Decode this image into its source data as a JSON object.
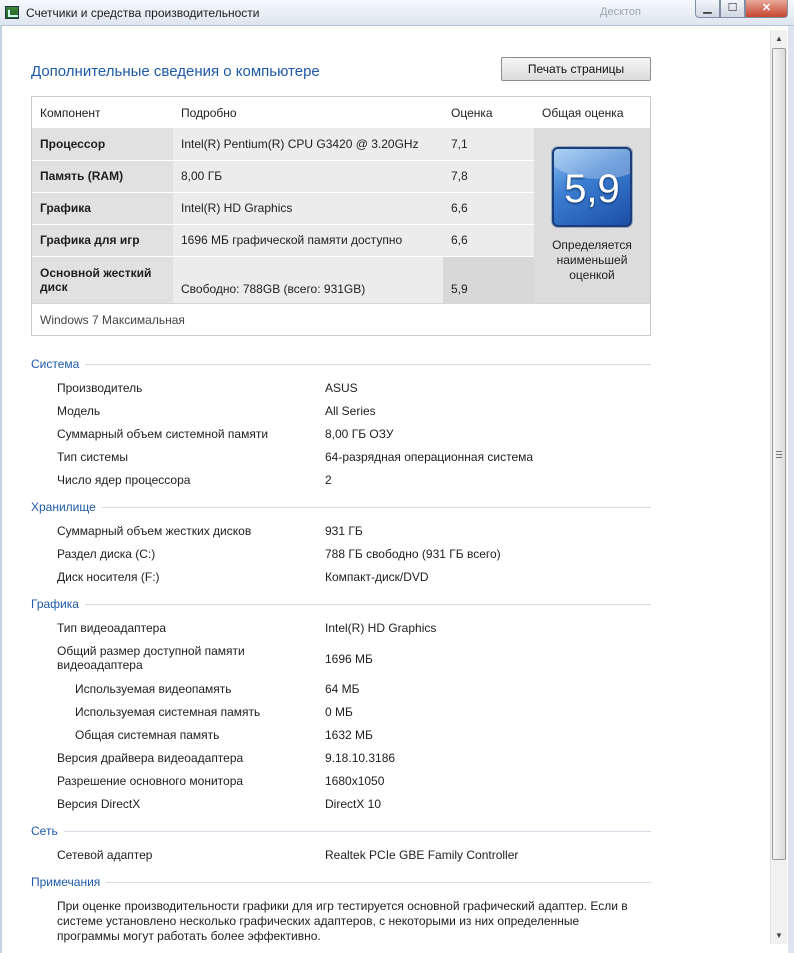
{
  "window": {
    "title": "Счетчики и средства производительности",
    "ghost": "Десктоп",
    "min": "▁",
    "max": "☐",
    "close": "✕"
  },
  "header": {
    "title": "Дополнительные сведения о компьютере",
    "print_label": "Печать страницы"
  },
  "scores": {
    "columns": [
      "Компонент",
      "Подробно",
      "Оценка",
      "Общая оценка"
    ],
    "rows": [
      {
        "component": "Процессор",
        "details": "Intel(R) Pentium(R) CPU G3420 @ 3.20GHz",
        "score": "7,1"
      },
      {
        "component": "Память (RAM)",
        "details": "8,00 ГБ",
        "score": "7,8"
      },
      {
        "component": "Графика",
        "details": "Intel(R) HD Graphics",
        "score": "6,6"
      },
      {
        "component": "Графика для игр",
        "details": "1696 МБ графической памяти доступно",
        "score": "6,6"
      },
      {
        "component": "Основной жесткий диск",
        "details": "Свободно: 788GB (всего: 931GB)",
        "score": "5,9"
      }
    ],
    "overall": "5,9",
    "overall_note": "Определяется наименьшей оценкой",
    "os": "Windows 7 Максимальная"
  },
  "system": {
    "title": "Система",
    "items": [
      {
        "k": "Производитель",
        "v": "ASUS"
      },
      {
        "k": "Модель",
        "v": "All Series"
      },
      {
        "k": "Суммарный объем системной памяти",
        "v": "8,00 ГБ ОЗУ"
      },
      {
        "k": "Тип системы",
        "v": "64-разрядная операционная система"
      },
      {
        "k": "Число ядер процессора",
        "v": "2"
      }
    ]
  },
  "storage": {
    "title": "Хранилище",
    "items": [
      {
        "k": "Суммарный объем жестких дисков",
        "v": "931 ГБ"
      },
      {
        "k": "Раздел диска (C:)",
        "v": "788 ГБ свободно (931 ГБ всего)"
      },
      {
        "k": "Диск носителя (F:)",
        "v": "Компакт-диск/DVD"
      }
    ]
  },
  "graphics": {
    "title": "Графика",
    "items": [
      {
        "k": "Тип видеоадаптера",
        "v": "Intel(R) HD Graphics"
      },
      {
        "k": "Общий размер доступной памяти видеоадаптера",
        "v": "1696 МБ"
      },
      {
        "k": "Используемая видеопамять",
        "v": "64 МБ"
      },
      {
        "k": "Используемая системная память",
        "v": "0 МБ"
      },
      {
        "k": "Общая системная память",
        "v": "1632 МБ"
      },
      {
        "k": "Версия драйвера видеоадаптера",
        "v": "9.18.10.3186"
      },
      {
        "k": "Разрешение основного монитора",
        "v": "1680x1050"
      },
      {
        "k": "Версия DirectX",
        "v": "DirectX 10"
      }
    ]
  },
  "network": {
    "title": "Сеть",
    "items": [
      {
        "k": "Сетевой адаптер",
        "v": "Realtek PCIe GBE Family Controller"
      }
    ]
  },
  "notes": {
    "title": "Примечания",
    "text": "При оценке производительности графики для игр тестируется основной графический адаптер. Если в системе установлено несколько графических адаптеров, с некоторыми из них определенные программы могут работать более эффективно."
  },
  "scrollbar": {
    "up": "▲",
    "down": "▼"
  }
}
